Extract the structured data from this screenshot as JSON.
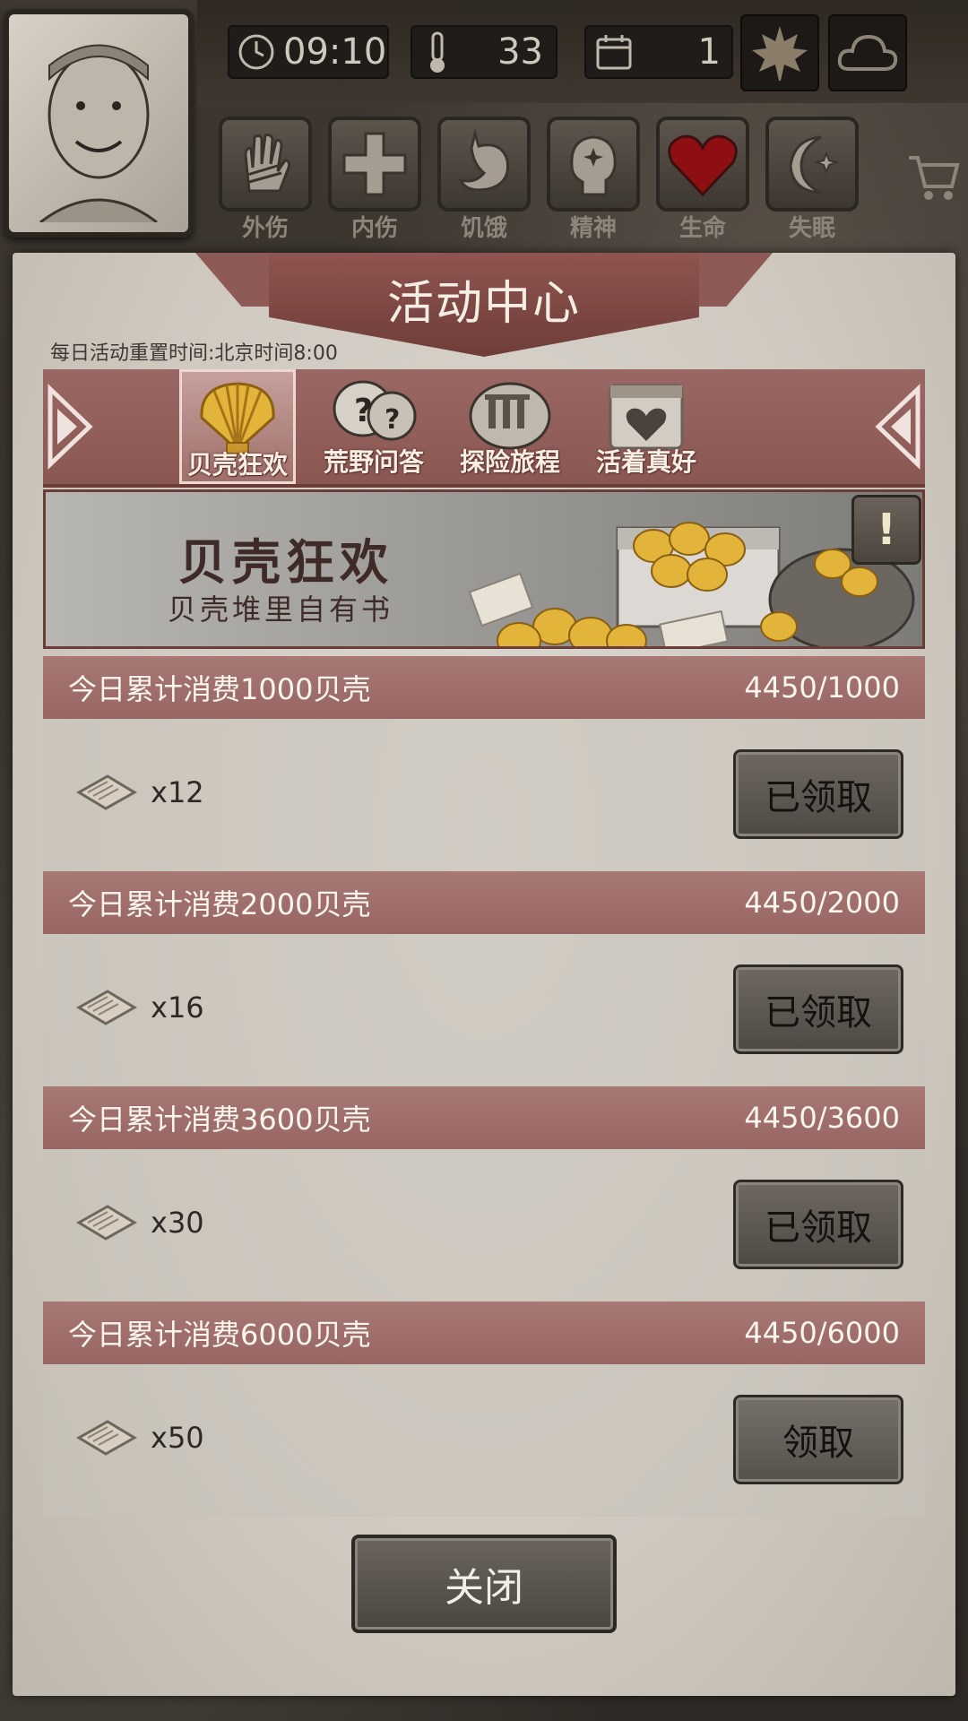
{
  "hud": {
    "time": "09:10",
    "temperature": "33",
    "day": "1"
  },
  "status": [
    {
      "label": "外伤",
      "icon": "hand-bandage-icon"
    },
    {
      "label": "内伤",
      "icon": "cross-icon"
    },
    {
      "label": "饥饿",
      "icon": "stomach-icon"
    },
    {
      "label": "精神",
      "icon": "head-sparkle-icon"
    },
    {
      "label": "生命",
      "icon": "heart-icon"
    },
    {
      "label": "失眠",
      "icon": "moon-star-icon"
    }
  ],
  "panel": {
    "title": "活动中心",
    "reset_text": "每日活动重置时间:北京时间8:00",
    "tabs": [
      {
        "label": "贝壳狂欢",
        "icon": "golden-shell-icon",
        "active": true
      },
      {
        "label": "荒野问答",
        "icon": "question-bubbles-icon",
        "active": false
      },
      {
        "label": "探险旅程",
        "icon": "ruins-icon",
        "active": false
      },
      {
        "label": "活着真好",
        "icon": "heart-calendar-icon",
        "active": false
      }
    ],
    "banner": {
      "title": "贝壳狂欢",
      "subtitle": "贝壳堆里自有书",
      "alert": "!"
    },
    "rows": [
      {
        "task": "今日累计消费1000贝壳",
        "progress": "4450/1000",
        "reward_qty": "x12",
        "button": "已领取",
        "claimed": true
      },
      {
        "task": "今日累计消费2000贝壳",
        "progress": "4450/2000",
        "reward_qty": "x16",
        "button": "已领取",
        "claimed": true
      },
      {
        "task": "今日累计消费3600贝壳",
        "progress": "4450/3600",
        "reward_qty": "x30",
        "button": "已领取",
        "claimed": true
      },
      {
        "task": "今日累计消费6000贝壳",
        "progress": "4450/6000",
        "reward_qty": "x50",
        "button": "领取",
        "claimed": false
      }
    ],
    "close_label": "关闭"
  },
  "colors": {
    "ribbon": "#8f5550",
    "row_header": "#a87874",
    "panel": "#d6d1c8"
  }
}
